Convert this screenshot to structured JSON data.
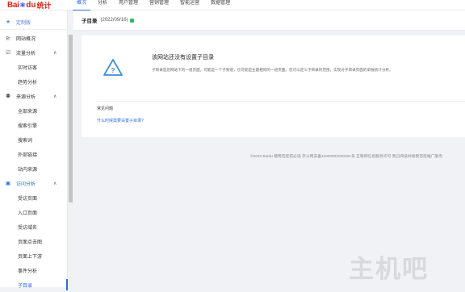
{
  "logo": {
    "part1": "Bai",
    "paw": "❀",
    "part2": "du",
    "product": "统计"
  },
  "topnav": [
    {
      "label": "概况",
      "active": true
    },
    {
      "label": "分析",
      "active": false
    },
    {
      "label": "用户管理",
      "active": false
    },
    {
      "label": "营销管理",
      "active": false
    },
    {
      "label": "智能运营",
      "active": false
    },
    {
      "label": "数据管理",
      "active": false
    }
  ],
  "sidebar": {
    "custom": "定制版",
    "overview": "网站概况",
    "traffic": {
      "label": "流量分析",
      "items": [
        "实时访客",
        "趋势分析"
      ]
    },
    "source": {
      "label": "来源分析",
      "items": [
        "全部来源",
        "搜索引擎",
        "搜索词",
        "外部链接",
        "站内来源"
      ]
    },
    "visit": {
      "label": "访问分析",
      "items": [
        "受访页面",
        "入口页面",
        "受访域名",
        "页面点击图",
        "页面上下游",
        "事件分析",
        "子目录"
      ]
    }
  },
  "subheader": {
    "title": "子目录",
    "date": "(2022/09/16)"
  },
  "message": {
    "title": "该网站还没有设置子目录",
    "description": "子目录是您网站下的一组页面，可能是一个子频道，也可能是主题相同的一组页面。您可以定义子目录的范围，实现对子目录页面的单独统计分析。"
  },
  "faq": {
    "title": "常见问题",
    "link": "什么时候需要设置子目录?"
  },
  "footer": "©2022 Baidu 使用百度前必读 京公网安备11000002000001号 互联网信息服务许可 我已阅读并接受百度推广服务",
  "watermark": "主机吧",
  "colors": {
    "accent": "#2f6bdb",
    "brand_red": "#d7261d",
    "warning_blue": "#3e8fd6",
    "status_green": "#35b960"
  }
}
